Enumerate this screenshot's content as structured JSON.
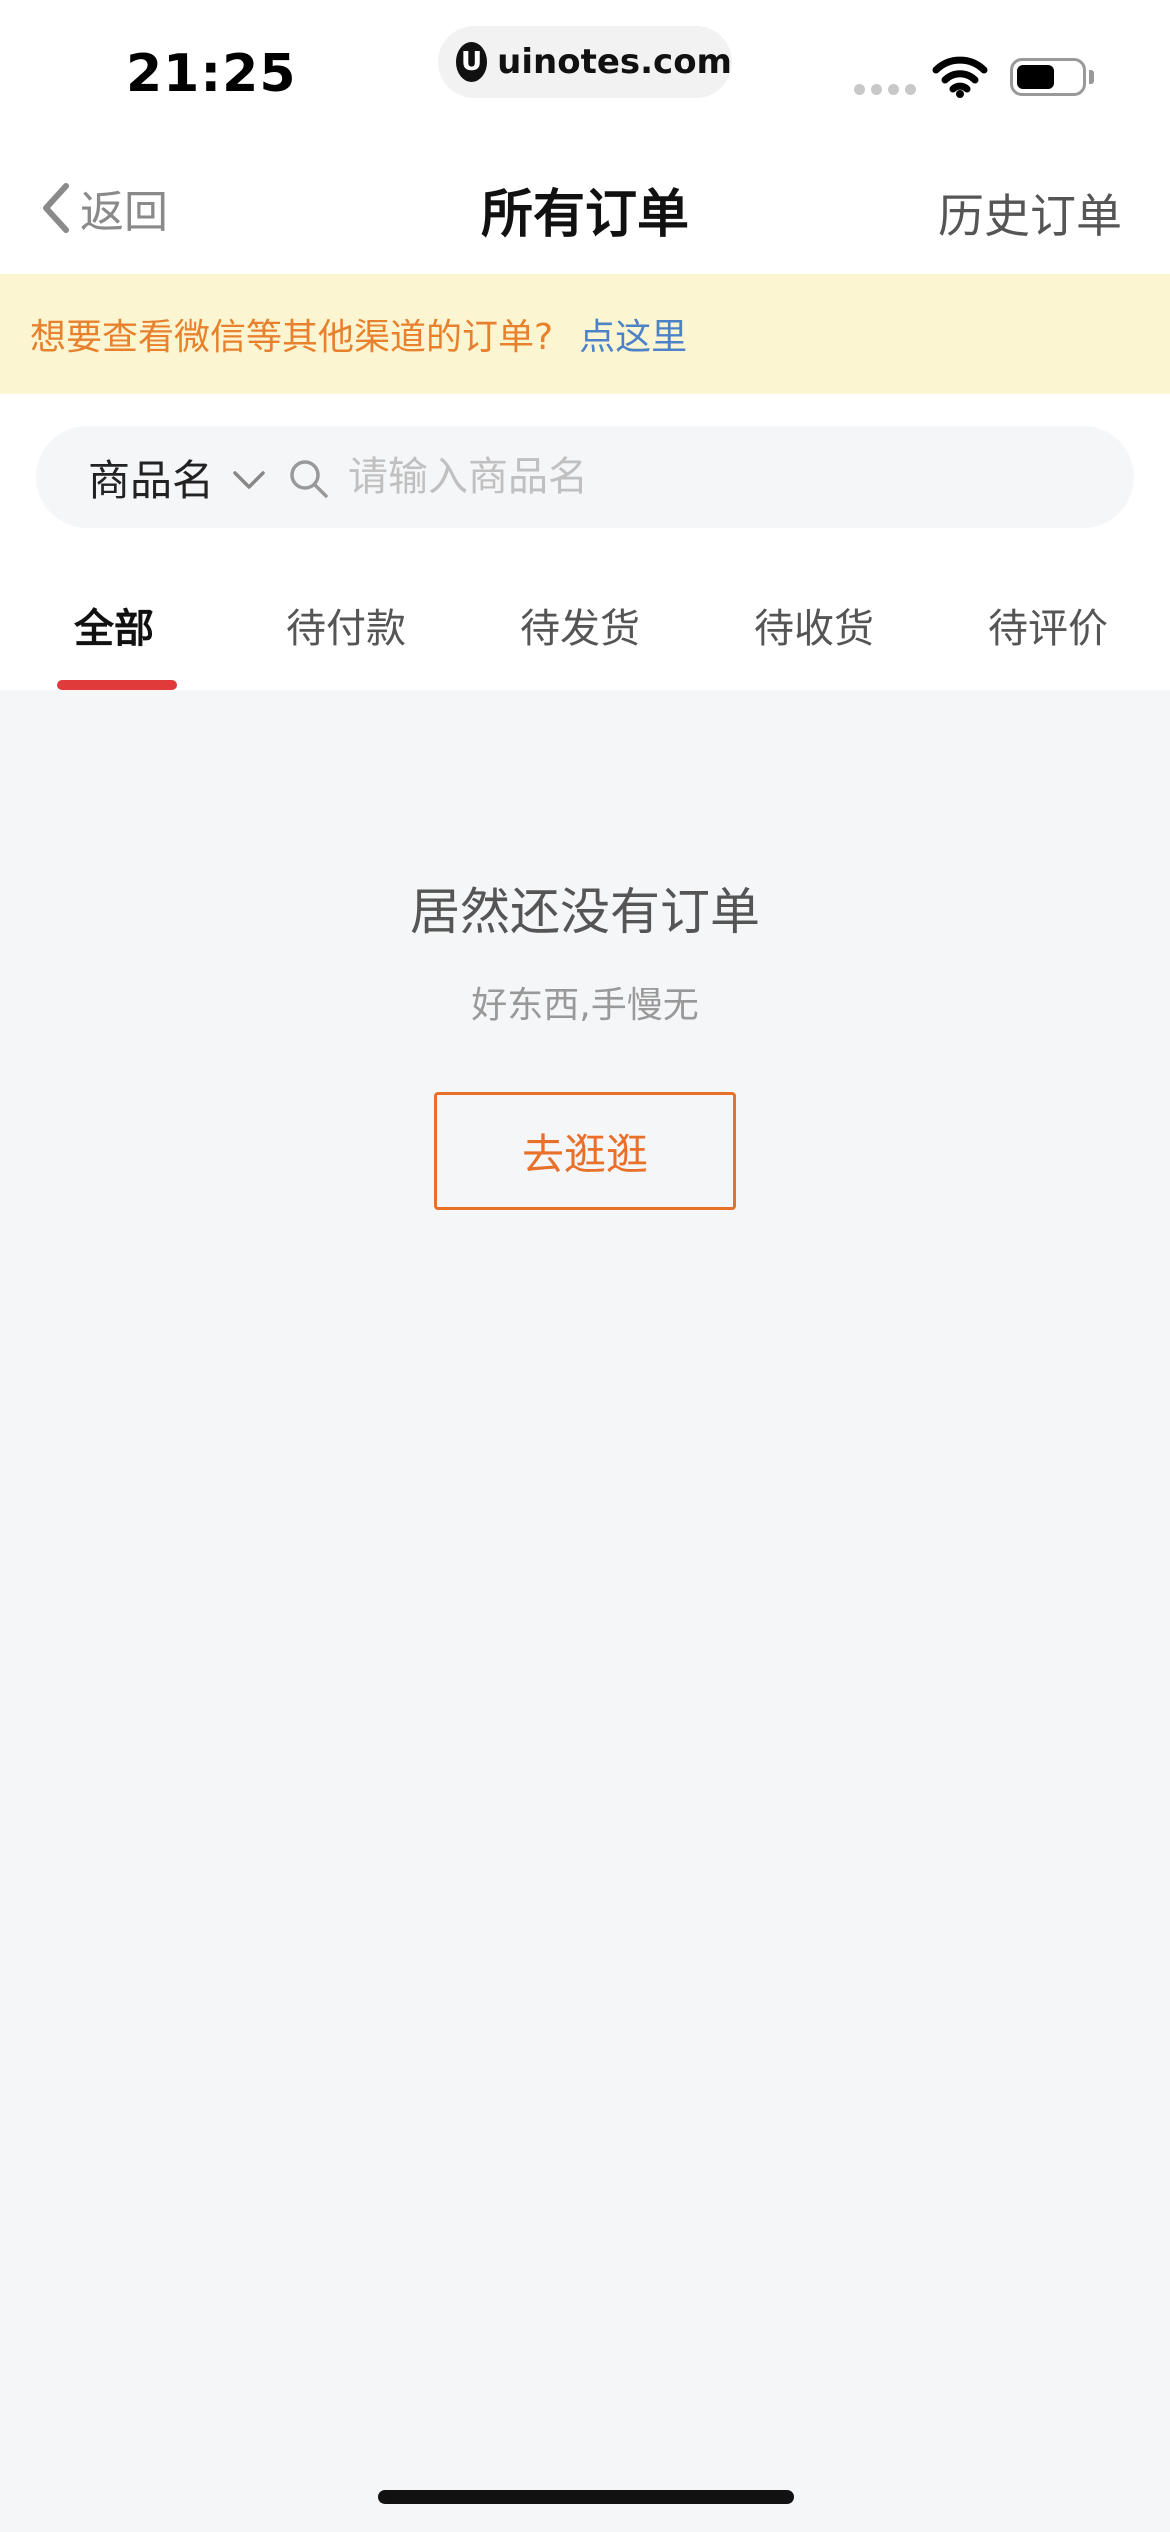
{
  "status_bar": {
    "time": "21:25",
    "url": "uinotes.com",
    "url_logo": "U"
  },
  "nav": {
    "back_label": "返回",
    "title": "所有订单",
    "history_label": "历史订单"
  },
  "notice": {
    "text": "想要查看微信等其他渠道的订单?",
    "link": "点这里"
  },
  "search": {
    "type_label": "商品名",
    "placeholder": "请输入商品名",
    "value": ""
  },
  "tabs": [
    {
      "label": "全部",
      "active": true
    },
    {
      "label": "待付款",
      "active": false
    },
    {
      "label": "待发货",
      "active": false
    },
    {
      "label": "待收货",
      "active": false
    },
    {
      "label": "待评价",
      "active": false
    }
  ],
  "empty": {
    "title": "居然还没有订单",
    "subtitle": "好东西,手慢无",
    "button_label": "去逛逛"
  },
  "colors": {
    "accent_orange": "#e8702a",
    "link_blue": "#4e82c8",
    "tab_indicator": "#e03a3a",
    "notice_bg": "#fbf6d1"
  }
}
